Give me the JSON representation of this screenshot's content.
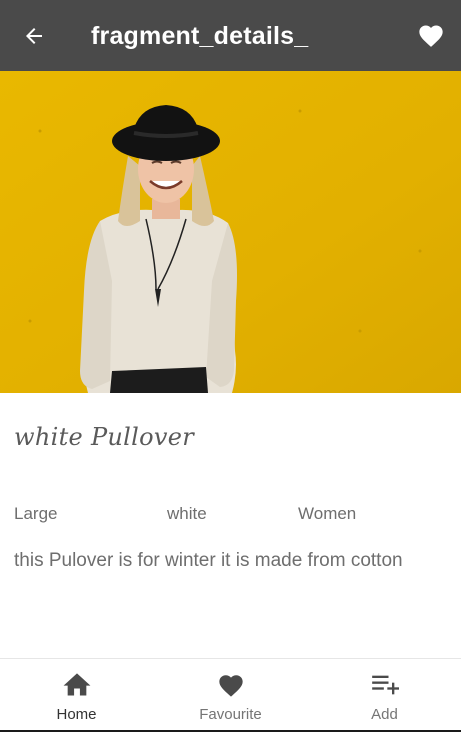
{
  "app_bar": {
    "title": "fragment_details_",
    "back_icon": "arrow-back-icon",
    "favourite_icon": "heart-icon"
  },
  "product": {
    "image_alt": "woman in white pullover against yellow wall",
    "name": "white Pullover",
    "size": "Large",
    "color": "white",
    "gender": "Women",
    "description": "this Pulover is for winter it is made from cotton"
  },
  "bottom_nav": {
    "items": [
      {
        "label": "Home",
        "icon": "home-icon",
        "selected": true
      },
      {
        "label": "Favourite",
        "icon": "heart-icon",
        "selected": false
      },
      {
        "label": "Add",
        "icon": "playlist-add-icon",
        "selected": false
      }
    ]
  },
  "colors": {
    "app_bar": "#4a4a4a",
    "hero_background": "#e4b400",
    "text_secondary": "#6e6e6e",
    "nav_icon": "#4a4a4a"
  }
}
